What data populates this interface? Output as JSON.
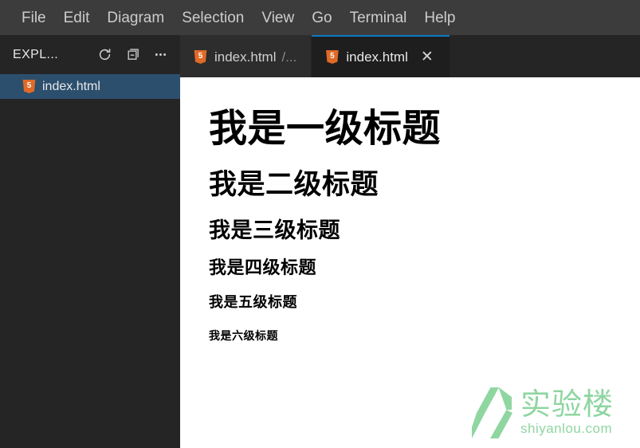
{
  "menubar": {
    "items": [
      {
        "label": "File",
        "name": "menu-file"
      },
      {
        "label": "Edit",
        "name": "menu-edit"
      },
      {
        "label": "Diagram",
        "name": "menu-diagram"
      },
      {
        "label": "Selection",
        "name": "menu-selection"
      },
      {
        "label": "View",
        "name": "menu-view"
      },
      {
        "label": "Go",
        "name": "menu-go"
      },
      {
        "label": "Terminal",
        "name": "menu-terminal"
      },
      {
        "label": "Help",
        "name": "menu-help"
      }
    ]
  },
  "sidebar": {
    "title": "EXPL...",
    "actions": [
      {
        "icon": "refresh-icon",
        "name": "refresh-explorer-button"
      },
      {
        "icon": "collapse-all-icon",
        "name": "collapse-all-button"
      },
      {
        "icon": "more-actions-icon",
        "name": "more-actions-button",
        "glyph": "···"
      }
    ],
    "files": [
      {
        "label": "index.html",
        "icon": "html5-file-icon",
        "icon_text": "5",
        "selected": true
      }
    ]
  },
  "tabs": [
    {
      "label": "index.html",
      "suffix": "/...",
      "icon_text": "5",
      "active": false,
      "closable": false
    },
    {
      "label": "index.html",
      "suffix": "",
      "icon_text": "5",
      "active": true,
      "closable": true,
      "close_glyph": "✕"
    }
  ],
  "preview": {
    "headings": [
      {
        "level": "h1",
        "text": "我是一级标题"
      },
      {
        "level": "h2",
        "text": "我是二级标题"
      },
      {
        "level": "h3",
        "text": "我是三级标题"
      },
      {
        "level": "h4",
        "text": "我是四级标题"
      },
      {
        "level": "h5",
        "text": "我是五级标题"
      },
      {
        "level": "h6",
        "text": "我是六级标题"
      }
    ]
  },
  "watermark": {
    "logo_cn": "实验楼",
    "logo_en": "shiyanlou.com",
    "color": "#8fd6a1"
  },
  "colors": {
    "menubar_bg": "#3c3c3c",
    "sidebar_bg": "#252526",
    "tab_active_bg": "#1e1e1e",
    "tab_inactive_bg": "#2d2d2d",
    "tab_active_border": "#0a7ac6",
    "selection_bg": "#2c4f6e",
    "file_icon": "#e06a28",
    "preview_bg": "#ffffff",
    "text_light": "#cccccc"
  }
}
